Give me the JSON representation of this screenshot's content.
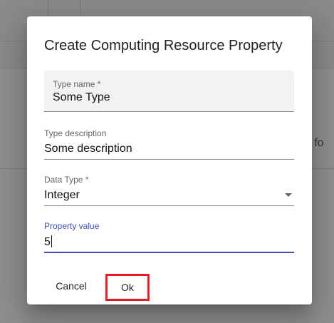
{
  "background": {
    "partial_text": "es fo"
  },
  "dialog": {
    "title": "Create Computing Resource Property",
    "fields": {
      "type_name": {
        "label": "Type name *",
        "value": "Some Type"
      },
      "type_description": {
        "label": "Type description",
        "value": "Some description"
      },
      "data_type": {
        "label": "Data Type *",
        "value": "Integer"
      },
      "property_value": {
        "label": "Property value",
        "value": "5"
      }
    },
    "buttons": {
      "cancel": "Cancel",
      "ok": "Ok"
    }
  },
  "colors": {
    "accent": "#3f51b5",
    "highlight_border": "#e41c23"
  },
  "icons": {
    "data_type_dropdown": "caret-down-icon"
  }
}
